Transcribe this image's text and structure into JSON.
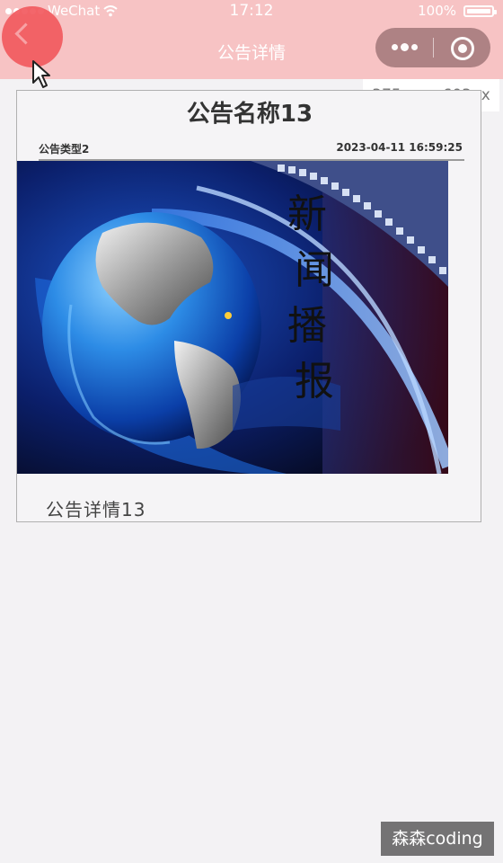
{
  "status_bar": {
    "carrier": "WeChat",
    "time": "17:12",
    "battery": "100%"
  },
  "nav": {
    "title": "公告详情"
  },
  "devtools": {
    "viewport_size": "375px × 603px"
  },
  "notice": {
    "title": "公告名称13",
    "type": "公告类型2",
    "datetime": "2023-04-11 16:59:25",
    "image_text": "新闻播报",
    "detail": "公告详情13"
  },
  "watermark": "森森coding",
  "colors": {
    "nav_background": "#f7c3c4",
    "page_background": "#f3f2f4",
    "accent_red": "#f25a5f"
  },
  "icons": [
    "signal-dots-icon",
    "wifi-icon",
    "battery-icon",
    "back-chevron-icon",
    "more-dots-icon",
    "target-circle-icon",
    "cursor-icon"
  ]
}
